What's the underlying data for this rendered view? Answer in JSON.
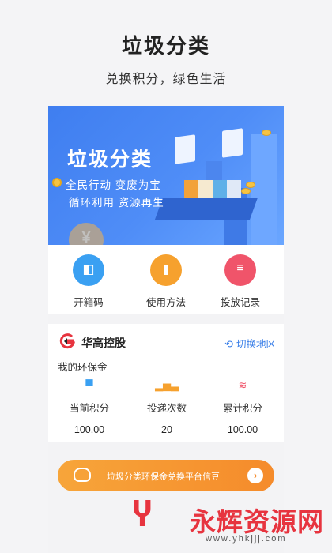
{
  "header": {
    "title": "垃圾分类",
    "subtitle": "兑换积分，绿色生活"
  },
  "banner": {
    "title": "垃圾分类",
    "line1": "全民行动 变废为宝",
    "line2": "循环利用 资源再生",
    "coin_symbol": "¥"
  },
  "actions": [
    {
      "label": "开箱码",
      "icon": "box-icon",
      "glyph": "◧"
    },
    {
      "label": "使用方法",
      "icon": "book-icon",
      "glyph": "▮"
    },
    {
      "label": "投放记录",
      "icon": "record-icon",
      "glyph": "≡"
    }
  ],
  "account": {
    "company": "华高控股",
    "switch_label": "切换地区",
    "wallet_label": "我的环保金",
    "stats": [
      {
        "label": "当前积分",
        "value": "100.00",
        "icon": "wallet-icon",
        "glyph": "▀"
      },
      {
        "label": "投递次数",
        "value": "20",
        "icon": "bar-chart-icon",
        "glyph": "▂▅▃"
      },
      {
        "label": "累计积分",
        "value": "100.00",
        "icon": "coins-stack-icon",
        "glyph": "≋"
      }
    ]
  },
  "exchange": {
    "label": "垃圾分类环保金兑换平台信豆",
    "arrow": "›"
  },
  "watermark": {
    "name": "永辉资源网",
    "url": "www.yhkjjj.com"
  },
  "colors": {
    "banner_blue": "#4f8df7",
    "action_blue": "#3aa0f2",
    "action_orange": "#f6a12e",
    "action_red": "#f0546a",
    "link_blue": "#3a7fe8",
    "exchange_orange": "#f58b2b",
    "watermark_red": "#e7343f"
  }
}
